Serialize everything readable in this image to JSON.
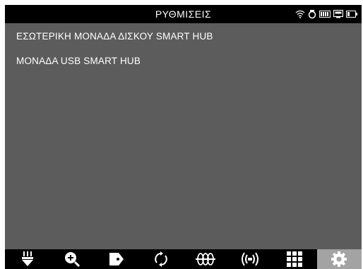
{
  "header": {
    "title": "ΡΥΘΜΙΣΕΙΣ",
    "status_icons": [
      "wifi-icon",
      "cloud-sync-icon",
      "battery-icon",
      "monitor-icon",
      "battery-low-icon"
    ]
  },
  "menu": {
    "items": [
      {
        "label": "ΕΣΩΤΕΡΙΚΗ ΜΟΝΑΔΑ ΔΙΣΚΟΥ SMART HUB"
      },
      {
        "label": "ΜΟΝΑΔΑ USB SMART HUB"
      }
    ]
  },
  "tabs": [
    {
      "icon": "flashlight-icon",
      "active": false
    },
    {
      "icon": "zoom-in-icon",
      "active": false
    },
    {
      "icon": "tag-icon",
      "active": false
    },
    {
      "icon": "refresh-icon",
      "active": false
    },
    {
      "icon": "coil-icon",
      "active": false
    },
    {
      "icon": "signal-icon",
      "active": false
    },
    {
      "icon": "grid-icon",
      "active": false
    },
    {
      "icon": "gear-icon",
      "active": true
    }
  ],
  "colors": {
    "background": "#5c5c5c",
    "bar": "#000000",
    "active_tab": "#a3a3a3",
    "text": "#ffffff"
  }
}
